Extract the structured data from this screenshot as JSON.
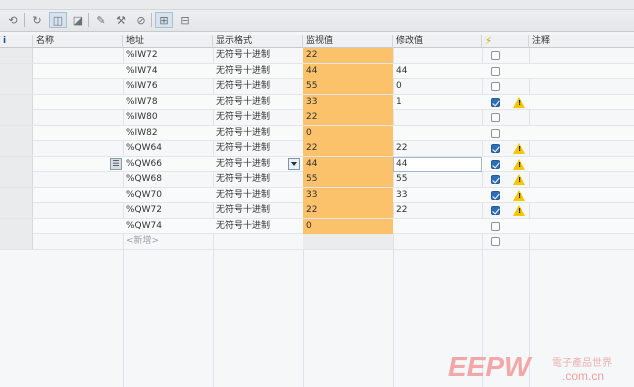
{
  "toolbar": {
    "icons": [
      "watch-table-icon",
      "refresh-icon",
      "monitor-all-icon",
      "monitor-once-icon",
      "modify-now-icon",
      "modify-trigger-icon",
      "disable-peripheral-icon",
      "show-hide-advanced-icon",
      "show-hide-forcing-icon"
    ]
  },
  "table": {
    "headers": {
      "index": "i",
      "name": "名称",
      "address": "地址",
      "display_format": "显示格式",
      "monitor_value": "监视值",
      "modify_value": "修改值",
      "modify_flag": "",
      "comment": "注释"
    },
    "rows": [
      {
        "address": "%IW72",
        "format": "无符号十进制",
        "monitor": "22",
        "modify": "",
        "checked": false,
        "warning": false
      },
      {
        "address": "%IW74",
        "format": "无符号十进制",
        "monitor": "44",
        "modify": "44",
        "checked": false,
        "warning": false
      },
      {
        "address": "%IW76",
        "format": "无符号十进制",
        "monitor": "55",
        "modify": "0",
        "checked": false,
        "warning": false
      },
      {
        "address": "%IW78",
        "format": "无符号十进制",
        "monitor": "33",
        "modify": "1",
        "checked": true,
        "warning": true
      },
      {
        "address": "%IW80",
        "format": "无符号十进制",
        "monitor": "22",
        "modify": "",
        "checked": false,
        "warning": false
      },
      {
        "address": "%IW82",
        "format": "无符号十进制",
        "monitor": "0",
        "modify": "",
        "checked": false,
        "warning": false
      },
      {
        "address": "%QW64",
        "format": "无符号十进制",
        "monitor": "22",
        "modify": "22",
        "checked": true,
        "warning": true
      },
      {
        "address": "%QW66",
        "format": "无符号十进制",
        "monitor": "44",
        "modify": "44",
        "checked": true,
        "warning": true
      },
      {
        "address": "%QW68",
        "format": "无符号十进制",
        "monitor": "55",
        "modify": "55",
        "checked": true,
        "warning": true
      },
      {
        "address": "%QW70",
        "format": "无符号十进制",
        "monitor": "33",
        "modify": "33",
        "checked": true,
        "warning": true
      },
      {
        "address": "%QW72",
        "format": "无符号十进制",
        "monitor": "22",
        "modify": "22",
        "checked": true,
        "warning": true
      },
      {
        "address": "%QW74",
        "format": "无符号十进制",
        "monitor": "0",
        "modify": "",
        "checked": false,
        "warning": false
      }
    ],
    "new_row": "<新增>"
  },
  "watermark": {
    "logo": "EEPW",
    "cn": "電子產品世界",
    "url": ".com.cn"
  },
  "colors": {
    "monitor_bg": "#fbc16b",
    "accent": "#2f6fb8",
    "warning": "#f3c600"
  }
}
